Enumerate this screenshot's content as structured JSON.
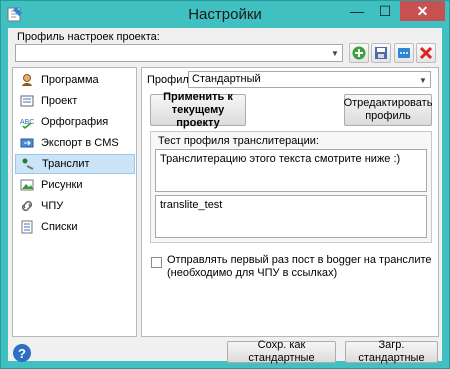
{
  "window": {
    "title": "Настройки",
    "minimize": "—",
    "maximize": "☐",
    "close": "✕"
  },
  "profile": {
    "label": "Профиль настроек проекта:",
    "value": ""
  },
  "sidebar": {
    "items": [
      {
        "label": "Программа",
        "icon": "program-icon"
      },
      {
        "label": "Проект",
        "icon": "project-icon"
      },
      {
        "label": "Орфография",
        "icon": "spelling-icon"
      },
      {
        "label": "Экспорт в CMS",
        "icon": "export-icon"
      },
      {
        "label": "Транслит",
        "icon": "translit-icon"
      },
      {
        "label": "Рисунки",
        "icon": "images-icon"
      },
      {
        "label": "ЧПУ",
        "icon": "url-icon"
      },
      {
        "label": "Списки",
        "icon": "lists-icon"
      }
    ],
    "selected_index": 4
  },
  "panel": {
    "profile_label": "Профиль:",
    "profile_value": "Стандартный",
    "apply_button": "Применить к текущему проекту",
    "edit_button": "Отредактировать профиль",
    "test_group_title": "Тест профиля транслитерации:",
    "test_input": "Транслитерацию этого текста смотрите ниже :)",
    "test_output": "translite_test",
    "checkbox_label": "Отправлять первый раз пост в bogger на транслите (необходимо для ЧПУ в ссылках)",
    "checkbox_checked": false
  },
  "footer": {
    "help": "?",
    "save_default": "Сохр. как стандартные",
    "load_default": "Загр. стандартные"
  },
  "colors": {
    "titlebar": "#40c0c0",
    "close": "#c75050",
    "selection": "#cce4f7"
  }
}
